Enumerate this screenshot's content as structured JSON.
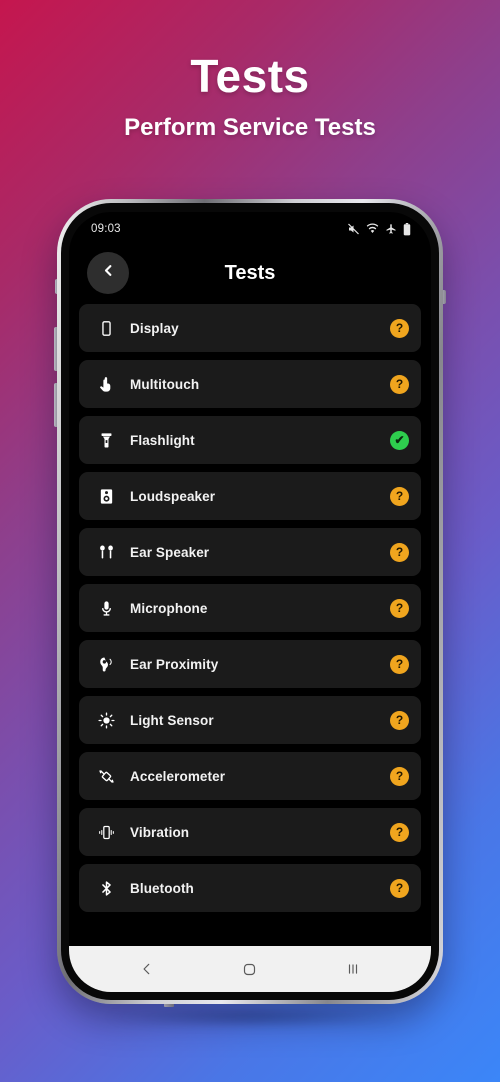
{
  "headline": {
    "title": "Tests",
    "subtitle": "Perform Service Tests"
  },
  "colors": {
    "background_top_left": "#c5164e",
    "background_mid": "#7a4fae",
    "background_bottom_right": "#3b86f8",
    "screen_background": "#000000",
    "row_background": "#1b1b1b",
    "badge_pending": "#f0a51e",
    "badge_pass": "#2ece4e",
    "navbar_background": "#f1f1f1",
    "text_primary": "#f2f2f2"
  },
  "phone": {
    "status_bar": {
      "time": "09:03",
      "icons": [
        "mute-icon",
        "wifi-icon",
        "airplane-mode-icon",
        "battery-icon"
      ]
    },
    "app_bar": {
      "back_icon": "chevron-left-icon",
      "title": "Tests"
    },
    "tests": [
      {
        "label": "Display",
        "icon": "display-icon",
        "status": "pending",
        "badge": "?"
      },
      {
        "label": "Multitouch",
        "icon": "touch-icon",
        "status": "pending",
        "badge": "?"
      },
      {
        "label": "Flashlight",
        "icon": "flashlight-icon",
        "status": "pass",
        "badge": "✔"
      },
      {
        "label": "Loudspeaker",
        "icon": "loudspeaker-icon",
        "status": "pending",
        "badge": "?"
      },
      {
        "label": "Ear Speaker",
        "icon": "earbuds-icon",
        "status": "pending",
        "badge": "?"
      },
      {
        "label": "Microphone",
        "icon": "microphone-icon",
        "status": "pending",
        "badge": "?"
      },
      {
        "label": "Ear Proximity",
        "icon": "ear-proximity-icon",
        "status": "pending",
        "badge": "?"
      },
      {
        "label": "Light Sensor",
        "icon": "light-sensor-icon",
        "status": "pending",
        "badge": "?"
      },
      {
        "label": "Accelerometer",
        "icon": "accelerometer-icon",
        "status": "pending",
        "badge": "?"
      },
      {
        "label": "Vibration",
        "icon": "vibration-icon",
        "status": "pending",
        "badge": "?"
      },
      {
        "label": "Bluetooth",
        "icon": "bluetooth-icon",
        "status": "pending",
        "badge": "?"
      }
    ],
    "nav_bar": {
      "back": "nav-back-icon",
      "home": "nav-home-icon",
      "recents": "nav-recents-icon"
    }
  }
}
